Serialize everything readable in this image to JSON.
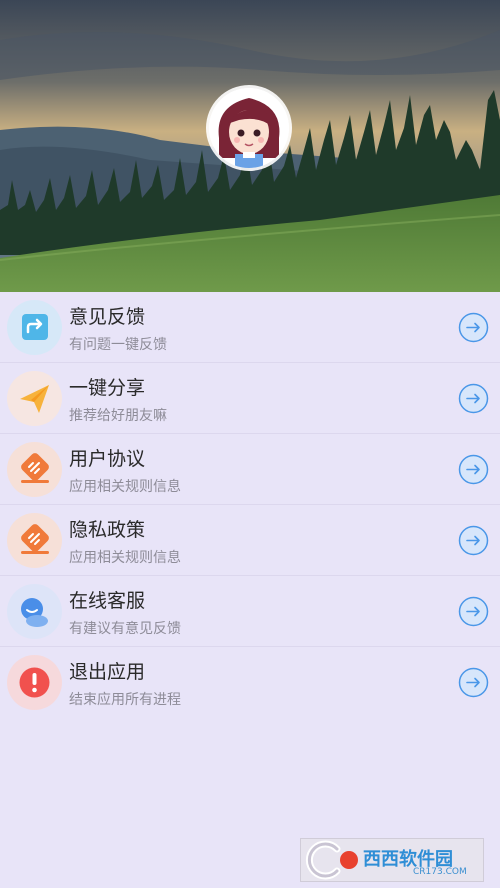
{
  "header": {
    "avatar": "avatar-girl"
  },
  "menu": [
    {
      "title": "意见反馈",
      "subtitle": "有问题一键反馈",
      "icon": "feedback-icon"
    },
    {
      "title": "一键分享",
      "subtitle": "推荐给好朋友嘛",
      "icon": "paper-plane-icon"
    },
    {
      "title": "用户协议",
      "subtitle": "应用相关规则信息",
      "icon": "document-icon"
    },
    {
      "title": "隐私政策",
      "subtitle": "应用相关规则信息",
      "icon": "document-icon"
    },
    {
      "title": "在线客服",
      "subtitle": "有建议有意见反馈",
      "icon": "chat-icon"
    },
    {
      "title": "退出应用",
      "subtitle": "结束应用所有进程",
      "icon": "exclamation-icon"
    }
  ],
  "watermark": {
    "brand": "西西软件园",
    "domain": "CR173.COM"
  },
  "colors": {
    "accent": "#4a97e8",
    "background": "#e8e4f8"
  }
}
